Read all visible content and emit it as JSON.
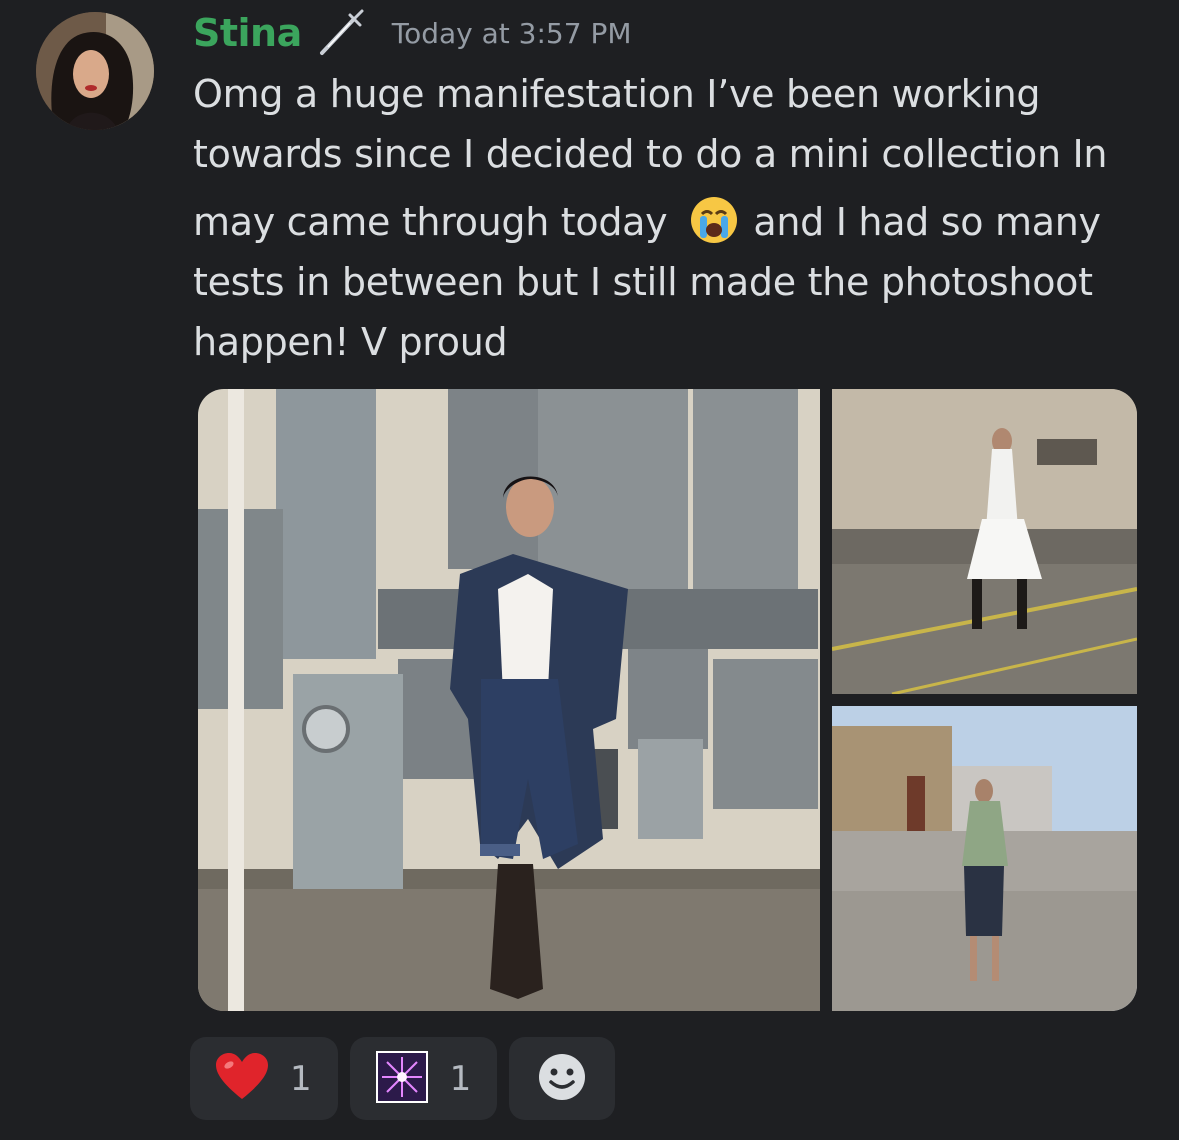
{
  "message": {
    "author": "Stina",
    "role_icon": "dagger-icon",
    "timestamp": "Today at 3:57 PM",
    "text_line_1": "Omg a huge manifestation I’ve been working",
    "text_line_2": "towards since I decided to do a mini collection In",
    "text_line_3a": "may came through today",
    "text_emoji": "loudly-crying-face",
    "text_line_3b": "and I had so many",
    "text_line_4": "tests in between but I still made the photoshoot",
    "text_line_5": "happen! V proud"
  },
  "attachments": [
    {
      "name": "photo-denim-outfit",
      "description": "woman in denim jacket and jorts leaning against electrical panels"
    },
    {
      "name": "photo-white-dress",
      "description": "woman in white corset dress and black boots on pavement"
    },
    {
      "name": "photo-green-blouse",
      "description": "woman in green blouse on rooftop"
    }
  ],
  "reactions": [
    {
      "emoji": "red-heart-icon",
      "count": "1"
    },
    {
      "emoji": "sparkler-icon",
      "count": "1"
    }
  ],
  "add_reaction_icon": "smiley-add-reaction-icon",
  "colors": {
    "background": "#1e1f22",
    "username": "#3ba55d",
    "timestamp": "#949ba4",
    "text": "#dbdee1",
    "reaction_bg": "#2b2d31"
  }
}
